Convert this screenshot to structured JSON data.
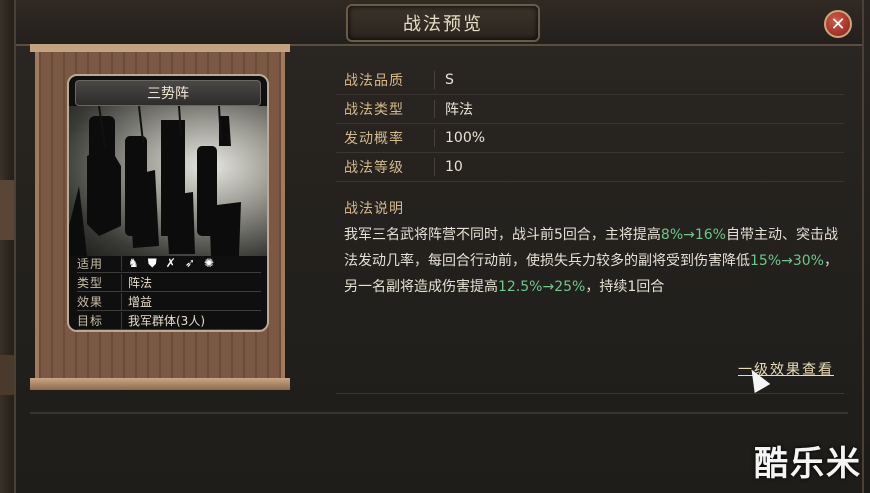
{
  "dialog": {
    "title": "战法预览"
  },
  "card": {
    "name": "三势阵",
    "info": [
      {
        "key": "适用",
        "value": ""
      },
      {
        "key": "类型",
        "value": "阵法"
      },
      {
        "key": "效果",
        "value": "增益"
      },
      {
        "key": "目标",
        "value": "我军群体(3人)"
      }
    ],
    "applicable_icons": [
      "cavalry-icon",
      "shield-icon",
      "archer-icon",
      "spear-icon",
      "siege-icon"
    ]
  },
  "stats": [
    {
      "key": "战法品质",
      "value": "S"
    },
    {
      "key": "战法类型",
      "value": "阵法"
    },
    {
      "key": "发动概率",
      "value": "100%"
    },
    {
      "key": "战法等级",
      "value": "10"
    }
  ],
  "description": {
    "label": "战法说明",
    "parts": [
      {
        "text": "我军三名武将阵营不同时，战斗前5回合，主将提高",
        "highlight": false
      },
      {
        "text": "8%→16%",
        "highlight": true
      },
      {
        "text": "自带主动、突击战法发动几率，每回合行动前，使损失兵力较多的副将受到伤害降低",
        "highlight": false
      },
      {
        "text": "15%→30%",
        "highlight": true
      },
      {
        "text": "，另一名副将造成伤害提高",
        "highlight": false
      },
      {
        "text": "12.5%→25%",
        "highlight": true
      },
      {
        "text": "，持续1回合",
        "highlight": false
      }
    ],
    "highlight_color": "#6ec68a"
  },
  "level_link": "一级效果查看",
  "watermark": "酷乐米"
}
